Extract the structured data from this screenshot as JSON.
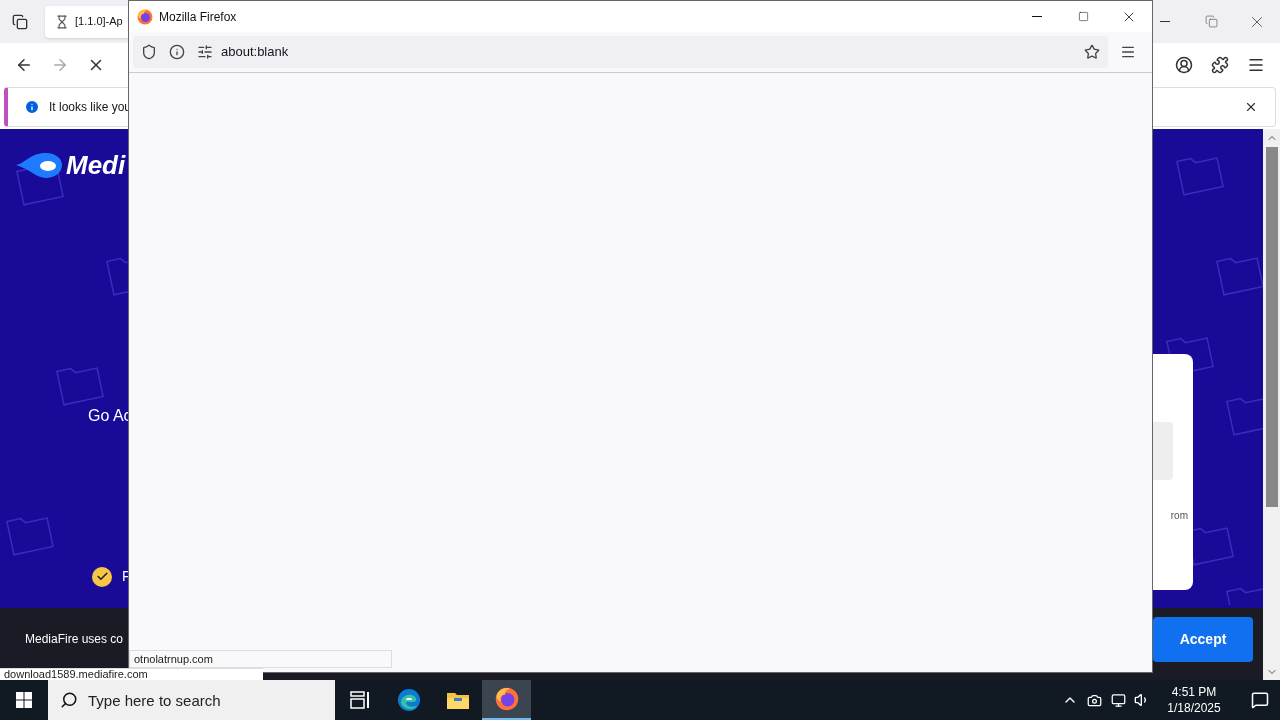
{
  "background_browser": {
    "tab": {
      "title": "[1.1.0]-Ap",
      "loading": true
    },
    "notification": {
      "text": "It looks like you"
    },
    "page": {
      "logo": "Medi",
      "headline": "Go Ac",
      "feature": "F",
      "cookie_text": "MediaFire uses co",
      "accept_button": "Accept",
      "card_text": "rom"
    },
    "status_link": "download1589.mediafire.com"
  },
  "popup": {
    "title": "Mozilla Firefox",
    "url": "about:blank",
    "status_link": "otnolatrnup.com"
  },
  "taskbar": {
    "search_placeholder": "Type here to search",
    "apps": [
      {
        "kind": "task_view",
        "selected": false
      },
      {
        "kind": "edge",
        "selected": false
      },
      {
        "kind": "explorer",
        "selected": false
      },
      {
        "kind": "firefox",
        "selected": true
      }
    ],
    "time": "4:51 PM",
    "date": "1/18/2025"
  }
}
